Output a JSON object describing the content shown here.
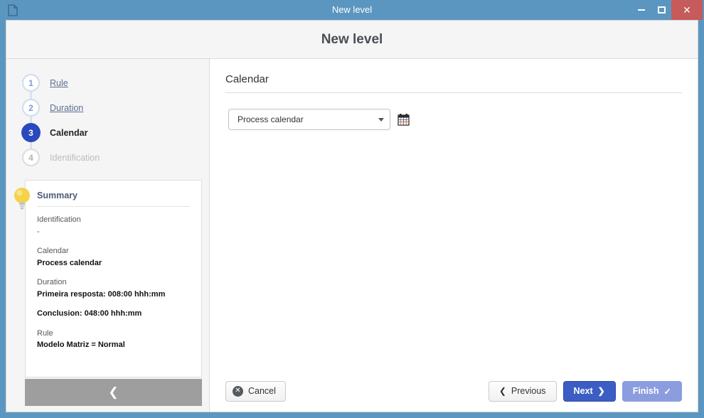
{
  "window": {
    "title": "New level",
    "doc_icon": "document-icon",
    "controls": {
      "minimize": "minimize-icon",
      "maximize": "maximize-icon",
      "close": "✕"
    },
    "titlebar_color": "#5b96c0",
    "close_color": "#c75a5a"
  },
  "header": {
    "title": "New level"
  },
  "sidebar": {
    "steps": [
      {
        "number": "1",
        "label": "Rule",
        "state": "done"
      },
      {
        "number": "2",
        "label": "Duration",
        "state": "done"
      },
      {
        "number": "3",
        "label": "Calendar",
        "state": "active"
      },
      {
        "number": "4",
        "label": "Identification",
        "state": "todo"
      }
    ],
    "summary": {
      "icon": "lightbulb-icon",
      "title": "Summary",
      "entries": [
        {
          "key": "Identification",
          "value": "-"
        },
        {
          "key": "Calendar",
          "value": "Process calendar"
        },
        {
          "key": "Duration",
          "value": "Primeira resposta: 008:00 hhh:mm"
        },
        {
          "key": "",
          "value": "Conclusion: 048:00 hhh:mm"
        },
        {
          "key": "Rule",
          "value": "Modelo Matriz = Normal"
        }
      ]
    },
    "collapse": {
      "icon": "chevron-left-icon",
      "glyph": "❮"
    }
  },
  "main": {
    "section_title": "Calendar",
    "calendar_select": {
      "value": "Process calendar",
      "caret": "chevron-down-icon"
    },
    "calendar_button_icon": "calendar-icon"
  },
  "footer": {
    "cancel": {
      "label": "Cancel",
      "icon": "cancel-circle-icon",
      "glyph": "✕"
    },
    "previous": {
      "label": "Previous",
      "icon": "chevron-left-icon",
      "glyph": "❮"
    },
    "next": {
      "label": "Next",
      "icon": "chevron-right-icon",
      "glyph": "❯"
    },
    "finish": {
      "label": "Finish",
      "icon": "check-icon",
      "glyph": "✓",
      "state": "disabled"
    }
  },
  "colors": {
    "accent_blue": "#3c5ec4",
    "accent_blue_disabled": "#8b9ddf",
    "titlebar": "#5b96c0",
    "step_active": "#2a49bd"
  }
}
